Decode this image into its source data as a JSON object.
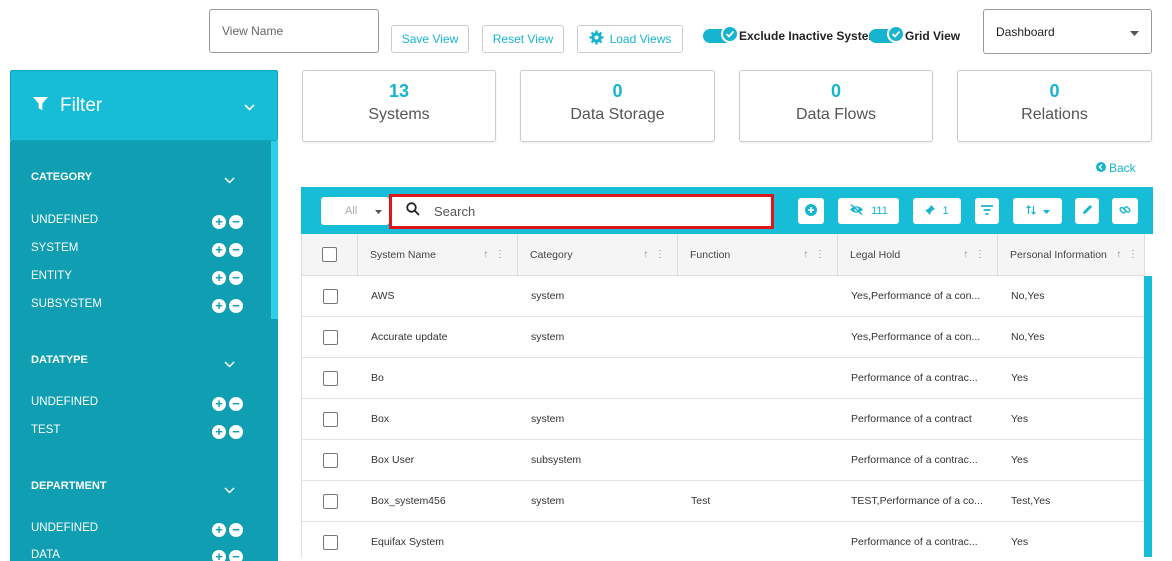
{
  "toolbar": {
    "view_name_placeholder": "View Name",
    "save_view": "Save View",
    "reset_view": "Reset View",
    "load_views": "Load Views",
    "exclude_inactive": "Exclude Inactive Systems",
    "grid_view": "Grid View",
    "dashboard_select": "Dashboard"
  },
  "filter": {
    "title": "Filter",
    "sections": [
      {
        "title": "CATEGORY",
        "items": [
          "UNDEFINED",
          "SYSTEM",
          "ENTITY",
          "SUBSYSTEM"
        ]
      },
      {
        "title": "DATATYPE",
        "items": [
          "UNDEFINED",
          "TEST"
        ]
      },
      {
        "title": "DEPARTMENT",
        "items": [
          "UNDEFINED",
          "DATA"
        ]
      }
    ]
  },
  "stats": [
    {
      "value": "13",
      "label": "Systems"
    },
    {
      "value": "0",
      "label": "Data Storage"
    },
    {
      "value": "0",
      "label": "Data Flows"
    },
    {
      "value": "0",
      "label": "Relations"
    }
  ],
  "back_label": "Back",
  "table_toolbar": {
    "all_label": "All",
    "search_placeholder": "Search",
    "hidden_count": "111",
    "pinned_count": "1"
  },
  "table": {
    "columns": [
      "System Name",
      "Category",
      "Function",
      "Legal Hold",
      "Personal Information"
    ],
    "rows": [
      [
        "AWS",
        "system",
        "",
        "Yes,Performance of a con...",
        "No,Yes"
      ],
      [
        "Accurate update",
        "system",
        "",
        "Yes,Performance of a con...",
        "No,Yes"
      ],
      [
        "Bo",
        "",
        "",
        "Performance of a contrac...",
        "Yes"
      ],
      [
        "Box",
        "system",
        "",
        "Performance of a contract",
        "Yes"
      ],
      [
        "Box User",
        "subsystem",
        "",
        "Performance of a contrac...",
        "Yes"
      ],
      [
        "Box_system456",
        "system",
        "Test",
        "TEST,Performance of a co...",
        "Test,Yes"
      ],
      [
        "Equifax System",
        "",
        "",
        "Performance of a contrac...",
        "Yes"
      ]
    ]
  },
  "colors": {
    "accent": "#17bcd6",
    "sidebar": "#0f9eb2",
    "highlight": "#e0161c"
  }
}
